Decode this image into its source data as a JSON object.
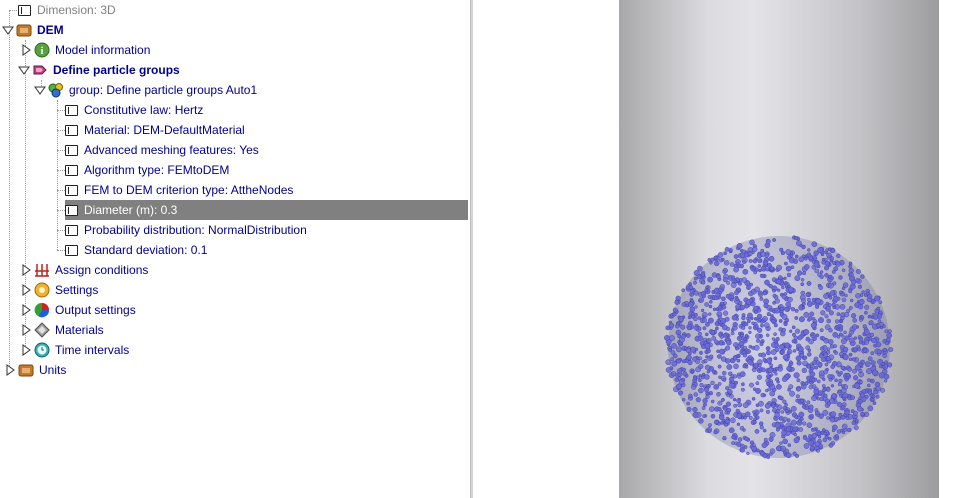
{
  "tree": {
    "dimension": "Dimension: 3D",
    "dem": "DEM",
    "model_information": "Model information",
    "define_particle_groups": "Define particle groups",
    "group": "group: Define particle groups Auto1",
    "constitutive_law": "Constitutive law: Hertz",
    "material": "Material: DEM-DefaultMaterial",
    "advanced_meshing": "Advanced meshing features: Yes",
    "algorithm_type": "Algorithm type: FEMtoDEM",
    "fem_to_dem_criterion": "FEM to DEM criterion type: AttheNodes",
    "diameter": "Diameter (m): 0.3",
    "probability_distribution": "Probability distribution: NormalDistribution",
    "standard_deviation": "Standard deviation: 0.1",
    "assign_conditions": "Assign conditions",
    "settings": "Settings",
    "output_settings": "Output settings",
    "materials": "Materials",
    "time_intervals": "Time intervals",
    "units": "Units"
  },
  "colors": {
    "text": "#00008b",
    "selection": "#808080",
    "particle": "#6a6ad8"
  }
}
